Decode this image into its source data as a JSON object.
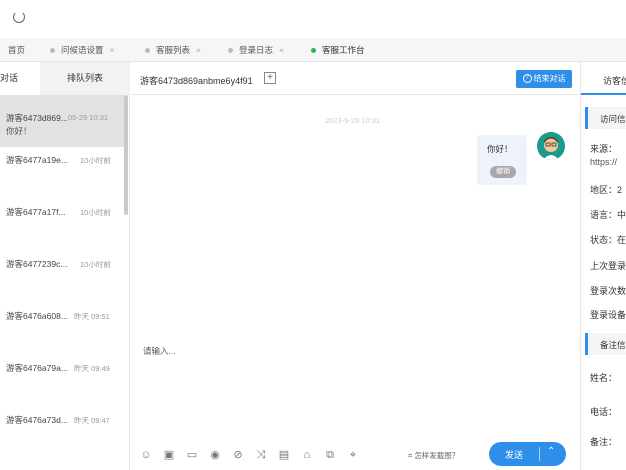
{
  "tabs": [
    {
      "label": "首页",
      "closable": false,
      "dot": "none"
    },
    {
      "label": "问候语设置",
      "closable": true,
      "dot": "grey"
    },
    {
      "label": "客服列表",
      "closable": true,
      "dot": "grey"
    },
    {
      "label": "登录日志",
      "closable": true,
      "dot": "grey"
    },
    {
      "label": "客服工作台",
      "closable": false,
      "dot": "green"
    }
  ],
  "tab_close_glyph": "×",
  "sidebar": {
    "tab_chat": "对话",
    "tab_queue": "排队列表",
    "sessions": [
      {
        "name": "游客6473d869...",
        "time": "05-29 10:31",
        "preview": "你好！"
      },
      {
        "name": "游客6477a19e...",
        "time": "10小时前",
        "preview": ""
      },
      {
        "name": "游客6477a17f...",
        "time": "10小时前",
        "preview": ""
      },
      {
        "name": "游客6477239c...",
        "time": "10小时前",
        "preview": ""
      },
      {
        "name": "游客6476a608...",
        "time": "昨天 09:51",
        "preview": ""
      },
      {
        "name": "游客6476a79a...",
        "time": "昨天 09:49",
        "preview": ""
      },
      {
        "name": "游客6476a73d...",
        "time": "昨天 09:47",
        "preview": ""
      }
    ]
  },
  "chat": {
    "title": "游客6473d869anbme6y4f91",
    "add_glyph": "+",
    "end_button": "结束对话",
    "end_icon": "?",
    "date": "2023-5-29 10:31",
    "message": "你好！",
    "revoke": "撤销",
    "input_placeholder": "请输入...",
    "screenshot_link": "怎样发截图？",
    "send": "发送",
    "send_chevron": "⌃",
    "tool_icons": [
      "☺",
      "▣",
      "▭",
      "◉",
      "⊘",
      "⤨",
      "▤",
      "⌂",
      "⧉",
      "⌖"
    ]
  },
  "right": {
    "tab": "访客信息",
    "section1": "访问信息",
    "source_label": "来源：",
    "source_value": "https://",
    "region": "地区：2",
    "language": "语言：中",
    "status": "状态：在",
    "last_login": "上次登录",
    "login_count": "登录次数",
    "login_device": "登录设备",
    "section2": "备注信息",
    "name_label": "姓名：",
    "phone_label": "电话：",
    "remark_label": "备注："
  },
  "colors": {
    "accent": "#2f8eea",
    "online": "#2db55d"
  }
}
